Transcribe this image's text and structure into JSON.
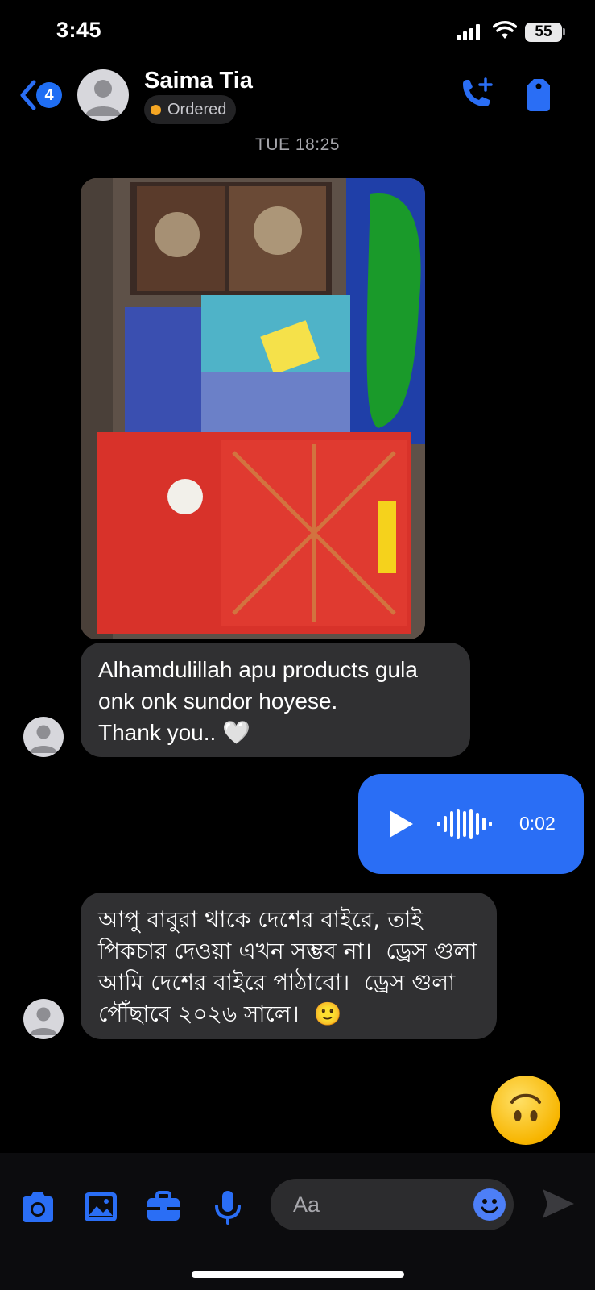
{
  "status_bar": {
    "time": "3:45",
    "battery": "55"
  },
  "header": {
    "unread_count": "4",
    "contact_name": "Saima Tia",
    "status": "Ordered",
    "status_color": "#f5a623"
  },
  "conversation": {
    "timestamp": "TUE 18:25",
    "message_1": "Alhamdulillah apu products gula\nonk onk sundor hoyese.\nThank you.. 🤍",
    "voice_message": {
      "duration": "0:02"
    },
    "message_2": "আপু বাবুরা থাকে দেশের বাইরে, তাই\nপিকচার দেওয়া এখন সম্ভব না।  ড্রেস গুলা\nআমি দেশের বাইরে পাঠাবো।  ড্রেস গুলা\nপৌঁছাবে ২০২৬ সালে।  🙂"
  },
  "composer": {
    "placeholder": "Aa"
  },
  "colors": {
    "accent": "#2a6ef5",
    "bubble_incoming": "#303032",
    "background": "#000000"
  },
  "icons": [
    "back-chevron-icon",
    "phone-add-icon",
    "tag-icon",
    "camera-icon",
    "gallery-icon",
    "toolbox-icon",
    "microphone-icon",
    "emoji-icon",
    "send-icon",
    "upside-down-face-icon"
  ]
}
